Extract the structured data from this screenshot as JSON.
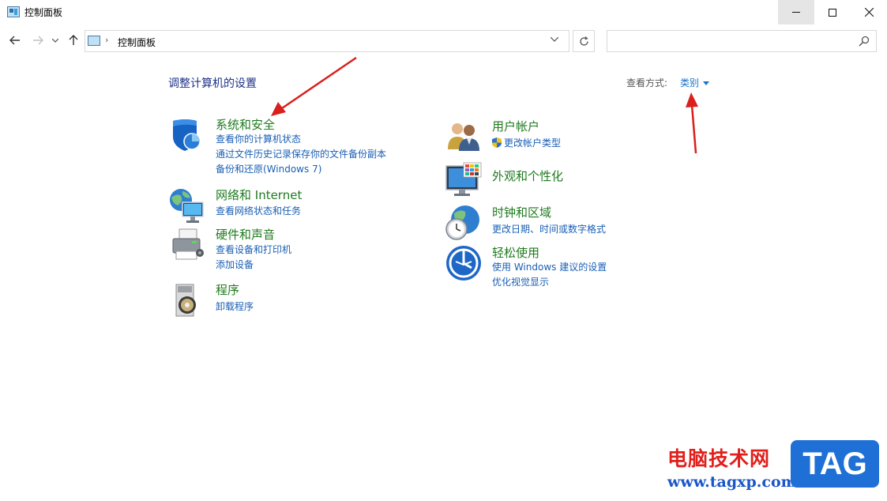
{
  "window": {
    "title": "控制面板"
  },
  "nav": {
    "address_path": "控制面板",
    "search_placeholder": ""
  },
  "main": {
    "heading": "调整计算机的设置",
    "view_by_label": "查看方式:",
    "view_by_value": "类别",
    "left_categories": [
      {
        "title": "系统和安全",
        "icon": "shield-icon",
        "links": [
          "查看你的计算机状态",
          "通过文件历史记录保存你的文件备份副本",
          "备份和还原(Windows 7)"
        ]
      },
      {
        "title": "网络和 Internet",
        "icon": "network-globe-icon",
        "links": [
          "查看网络状态和任务"
        ]
      },
      {
        "title": "硬件和声音",
        "icon": "printer-icon",
        "links": [
          "查看设备和打印机",
          "添加设备"
        ]
      },
      {
        "title": "程序",
        "icon": "programs-disc-icon",
        "links": [
          "卸载程序"
        ]
      }
    ],
    "right_categories": [
      {
        "title": "用户帐户",
        "icon": "users-icon",
        "links": [
          "更改帐户类型"
        ]
      },
      {
        "title": "外观和个性化",
        "icon": "monitor-palette-icon",
        "links": []
      },
      {
        "title": "时钟和区域",
        "icon": "clock-globe-icon",
        "links": [
          "更改日期、时间或数字格式"
        ]
      },
      {
        "title": "轻松使用",
        "icon": "ease-of-access-icon",
        "links": [
          "使用 Windows 建议的设置",
          "优化视觉显示"
        ]
      }
    ]
  },
  "watermark": {
    "site_name": "电脑技术网",
    "url": "www.tagxp.com",
    "badge": "TAG"
  },
  "colors": {
    "heading": "#1e3287",
    "category_title": "#1e7a1e",
    "link": "#1a5fb4",
    "annotation_arrow": "#d9201c",
    "watermark_red": "#e0201c",
    "watermark_blue": "#1f70d6"
  }
}
